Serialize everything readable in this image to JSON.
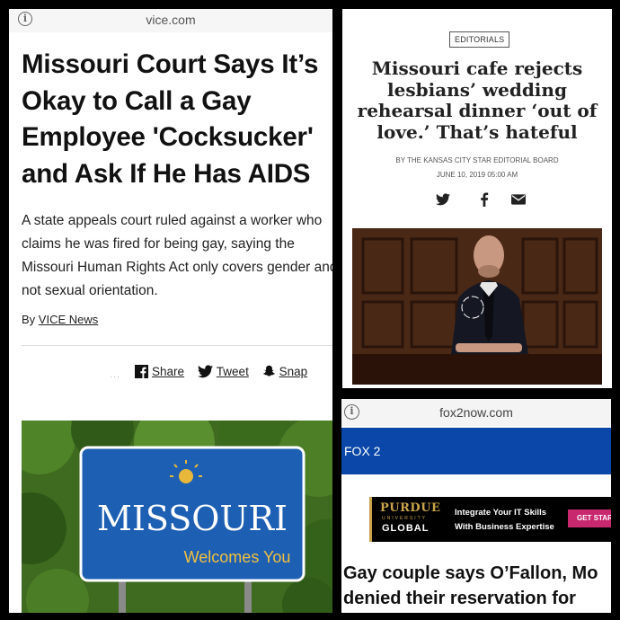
{
  "vice": {
    "url": "vice.com",
    "headline": [
      "Missouri Court Says It’s",
      "Okay to Call a Gay",
      "Employee 'Cocksucker'",
      "and Ask If He Has AIDS"
    ],
    "dek": [
      "A state appeals court ruled against a worker who",
      "claims he was fired for being gay, saying the",
      "Missouri Human Rights Act only covers gender and",
      "not sexual orientation."
    ],
    "byline_prefix": "By",
    "byline_author": "VICE News",
    "share": {
      "share": "Share",
      "tweet": "Tweet",
      "snap": "Snap"
    },
    "photo": {
      "sign_main": "MISSOURI",
      "sign_sub": "Welcomes You"
    }
  },
  "kcs": {
    "badge": "EDITORIALS",
    "headline": [
      "Missouri cafe rejects",
      "lesbians’ wedding",
      "rehearsal dinner ‘out of",
      "love.’ That’s hateful"
    ],
    "byline": "BY THE KANSAS CITY STAR EDITORIAL BOARD",
    "date": "JUNE 10, 2019 05:00 AM",
    "social_icons": [
      "twitter-icon",
      "facebook-icon",
      "email-icon"
    ]
  },
  "fox": {
    "url": "fox2now.com",
    "nav_label": "FOX 2",
    "ad": {
      "brand": "PURDUE",
      "brand_sub": "UNIVERSITY",
      "brand_global": "GLOBAL",
      "line1": "Integrate Your IT Skills",
      "line2": "With Business Expertise",
      "cta": "GET STAR"
    },
    "headline": [
      "Gay couple says O’Fallon, Mo",
      "denied their reservation for"
    ]
  },
  "colors": {
    "fox_blue": "#0a47a8",
    "purdue_gold": "#c9a44a",
    "ad_cta": "#c8286e",
    "sign_blue": "#1d5fb3"
  }
}
